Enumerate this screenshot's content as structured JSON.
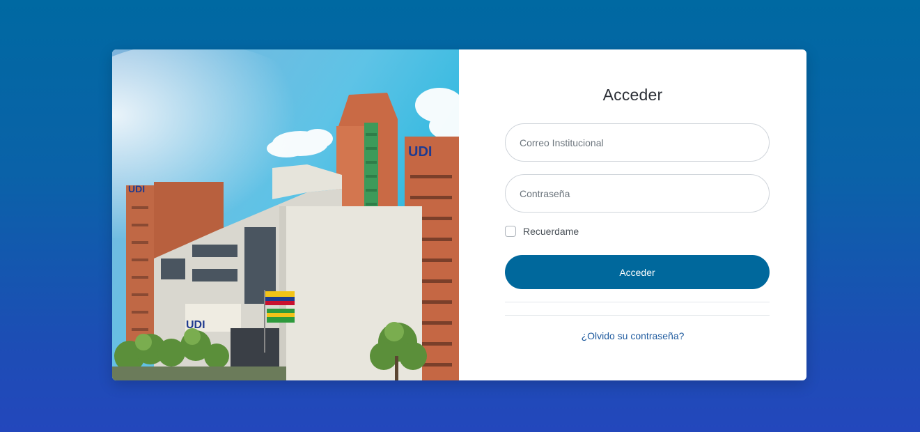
{
  "photo": {
    "building_logo_left": "UDI",
    "building_logo_right": "UDI",
    "building_logo_front": "UDI"
  },
  "login": {
    "title": "Acceder",
    "email_placeholder": "Correo Institucional",
    "password_placeholder": "Contraseña",
    "remember_label": "Recuerdame",
    "submit_label": "Acceder",
    "forgot_link": "¿Olvido su contraseña?"
  },
  "colors": {
    "primary": "#00689c",
    "background_top": "#0069a2",
    "background_bottom": "#2347bc",
    "link": "#1e5a9e"
  }
}
